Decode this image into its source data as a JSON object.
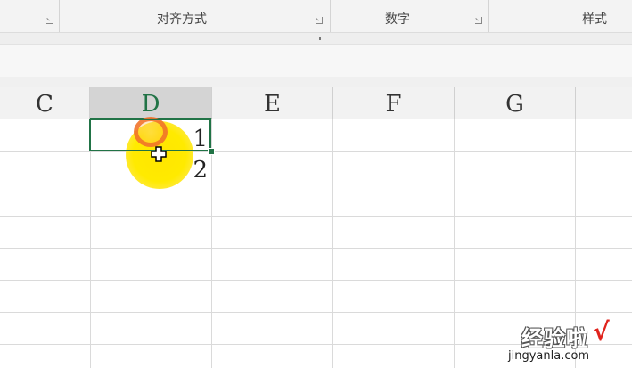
{
  "ribbon": {
    "groups": [
      {
        "label": "对齐方式"
      },
      {
        "label": "数字"
      },
      {
        "label": "样式"
      }
    ]
  },
  "columns": [
    {
      "letter": "C"
    },
    {
      "letter": "D",
      "selected": true
    },
    {
      "letter": "E"
    },
    {
      "letter": "F"
    },
    {
      "letter": "G"
    }
  ],
  "cells": {
    "D1": "1",
    "D2": "2"
  },
  "colors": {
    "accent": "#217346",
    "cursor_highlight": "#ffe600",
    "click_ring": "#f06e28"
  },
  "cursor": {
    "icon": "crosshair-plus-icon"
  },
  "watermark": {
    "brand": "经验啦",
    "check": "√",
    "url": "jingyanla.com"
  }
}
